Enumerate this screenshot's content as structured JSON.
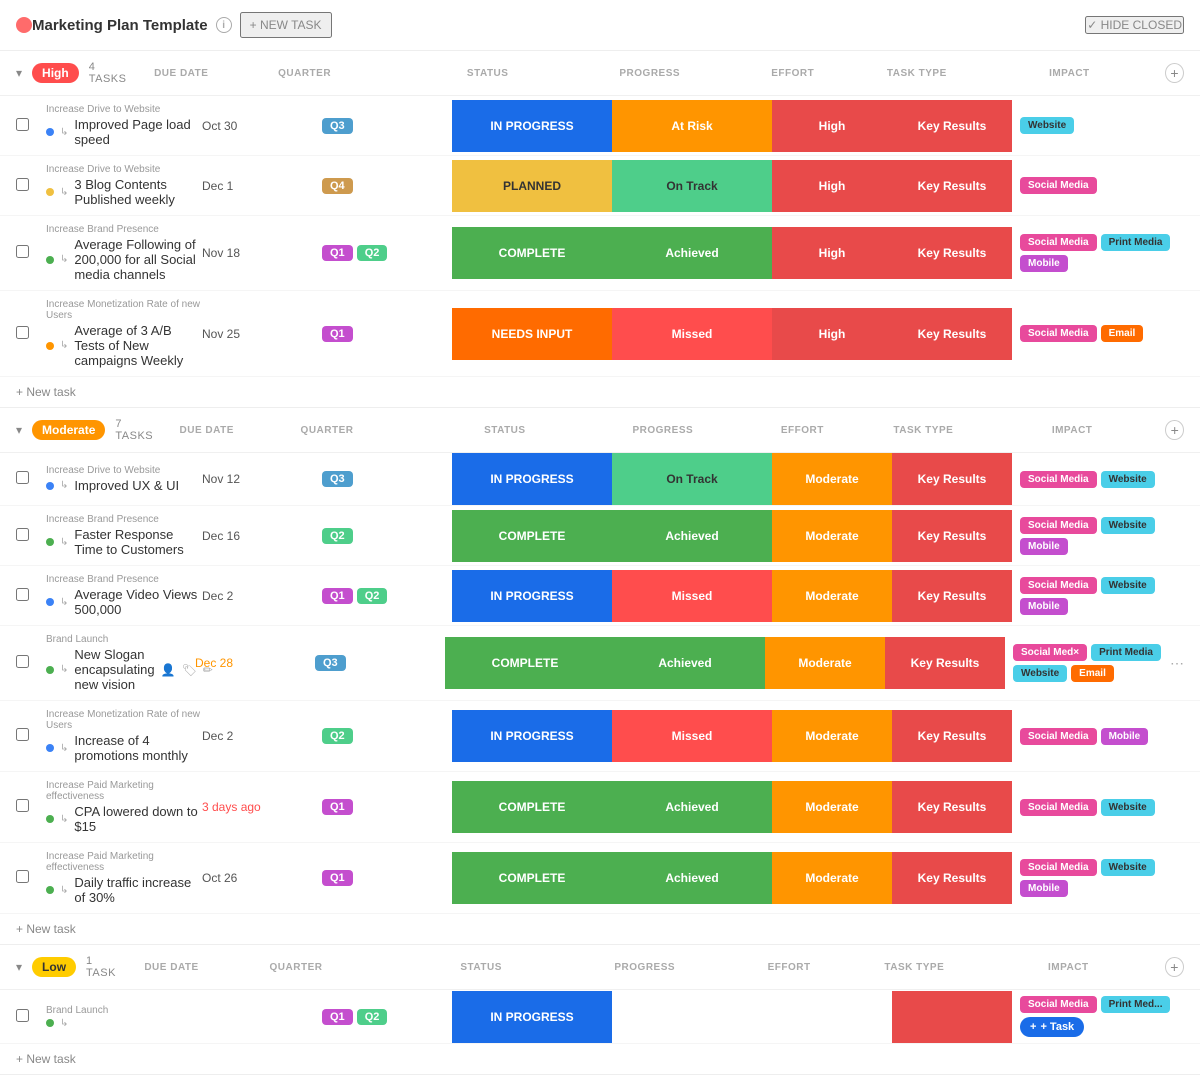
{
  "header": {
    "icon": "●",
    "title": "Marketing Plan Template",
    "new_task_label": "+ NEW TASK",
    "hide_closed_label": "✓ HIDE CLOSED"
  },
  "columns": {
    "task": "",
    "due_date": "DUE DATE",
    "quarter": "QUARTER",
    "status": "STATUS",
    "progress": "PROGRESS",
    "effort": "EFFORT",
    "task_type": "TASK TYPE",
    "impact": "IMPACT"
  },
  "sections": [
    {
      "id": "high",
      "priority": "High",
      "priority_class": "priority-high",
      "task_count": "4 TASKS",
      "tasks": [
        {
          "category": "Increase Drive to Website",
          "name": "Improved Page load speed",
          "dot_color": "#3b82f6",
          "due_date": "Oct 30",
          "due_date_class": "",
          "quarters": [
            {
              "label": "Q3",
              "class": "q3"
            }
          ],
          "status": "IN PROGRESS",
          "status_class": "status-in-progress",
          "progress": "At Risk",
          "progress_class": "progress-at-risk",
          "effort": "High",
          "effort_class": "effort-high",
          "task_type": "Key Results",
          "impact_tags": [
            {
              "label": "Website",
              "class": "tag-website"
            }
          ]
        },
        {
          "category": "Increase Drive to Website",
          "name": "3 Blog Contents Published weekly",
          "dot_color": "#f0c040",
          "due_date": "Dec 1",
          "due_date_class": "",
          "quarters": [
            {
              "label": "Q4",
              "class": "q4"
            }
          ],
          "status": "PLANNED",
          "status_class": "status-planned",
          "progress": "On Track",
          "progress_class": "progress-on-track",
          "effort": "High",
          "effort_class": "effort-high",
          "task_type": "Key Results",
          "impact_tags": [
            {
              "label": "Social Media",
              "class": "tag-social-media"
            }
          ]
        },
        {
          "category": "Increase Brand Presence",
          "name": "Average Following of 200,000 for all Social media channels",
          "dot_color": "#4caf50",
          "due_date": "Nov 18",
          "due_date_class": "",
          "quarters": [
            {
              "label": "Q1",
              "class": "q1"
            },
            {
              "label": "Q2",
              "class": "q2"
            }
          ],
          "status": "COMPLETE",
          "status_class": "status-complete",
          "progress": "Achieved",
          "progress_class": "progress-achieved",
          "effort": "High",
          "effort_class": "effort-high",
          "task_type": "Key Results",
          "impact_tags": [
            {
              "label": "Social Media",
              "class": "tag-social-media"
            },
            {
              "label": "Print Media",
              "class": "tag-print-media"
            },
            {
              "label": "Mobile",
              "class": "tag-mobile"
            }
          ]
        },
        {
          "category": "Increase Monetization Rate of new Users",
          "name": "Average of 3 A/B Tests of New campaigns Weekly",
          "dot_color": "#ff9500",
          "due_date": "Nov 25",
          "due_date_class": "",
          "quarters": [
            {
              "label": "Q1",
              "class": "q1"
            }
          ],
          "status": "NEEDS INPUT",
          "status_class": "status-needs-input",
          "progress": "Missed",
          "progress_class": "progress-missed",
          "effort": "High",
          "effort_class": "effort-high",
          "task_type": "Key Results",
          "impact_tags": [
            {
              "label": "Social Media",
              "class": "tag-social-media"
            },
            {
              "label": "Email",
              "class": "tag-email"
            }
          ]
        }
      ]
    },
    {
      "id": "moderate",
      "priority": "Moderate",
      "priority_class": "priority-moderate",
      "task_count": "7 TASKS",
      "tasks": [
        {
          "category": "Increase Drive to Website",
          "name": "Improved UX & UI",
          "dot_color": "#3b82f6",
          "due_date": "Nov 12",
          "due_date_class": "",
          "quarters": [
            {
              "label": "Q3",
              "class": "q3"
            }
          ],
          "status": "IN PROGRESS",
          "status_class": "status-in-progress",
          "progress": "On Track",
          "progress_class": "progress-on-track",
          "effort": "Moderate",
          "effort_class": "effort-moderate",
          "task_type": "Key Results",
          "impact_tags": [
            {
              "label": "Social Media",
              "class": "tag-social-media"
            },
            {
              "label": "Website",
              "class": "tag-website"
            }
          ]
        },
        {
          "category": "Increase Brand Presence",
          "name": "Faster Response Time to Customers",
          "dot_color": "#4caf50",
          "due_date": "Dec 16",
          "due_date_class": "",
          "quarters": [
            {
              "label": "Q2",
              "class": "q2"
            }
          ],
          "status": "COMPLETE",
          "status_class": "status-complete",
          "progress": "Achieved",
          "progress_class": "progress-achieved",
          "effort": "Moderate",
          "effort_class": "effort-moderate",
          "task_type": "Key Results",
          "impact_tags": [
            {
              "label": "Social Media",
              "class": "tag-social-media"
            },
            {
              "label": "Website",
              "class": "tag-website"
            },
            {
              "label": "Mobile",
              "class": "tag-mobile"
            }
          ]
        },
        {
          "category": "Increase Brand Presence",
          "name": "Average Video Views 500,000",
          "dot_color": "#3b82f6",
          "due_date": "Dec 2",
          "due_date_class": "",
          "quarters": [
            {
              "label": "Q1",
              "class": "q1"
            },
            {
              "label": "Q2",
              "class": "q2"
            }
          ],
          "status": "IN PROGRESS",
          "status_class": "status-in-progress",
          "progress": "Missed",
          "progress_class": "progress-missed",
          "effort": "Moderate",
          "effort_class": "effort-moderate",
          "task_type": "Key Results",
          "impact_tags": [
            {
              "label": "Social Media",
              "class": "tag-social-media"
            },
            {
              "label": "Website",
              "class": "tag-website"
            },
            {
              "label": "Mobile",
              "class": "tag-mobile"
            }
          ]
        },
        {
          "category": "Brand Launch",
          "name": "New Slogan encapsulating new vision",
          "dot_color": "#4caf50",
          "due_date": "Dec 28",
          "due_date_class": "upcoming",
          "quarters": [
            {
              "label": "Q3",
              "class": "q3"
            }
          ],
          "status": "COMPLETE",
          "status_class": "status-complete",
          "progress": "Achieved",
          "progress_class": "progress-achieved",
          "effort": "Moderate",
          "effort_class": "effort-moderate",
          "task_type": "Key Results",
          "impact_tags": [
            {
              "label": "Social Med×",
              "class": "tag-social-media"
            },
            {
              "label": "Print Media",
              "class": "tag-print-media"
            },
            {
              "label": "Website",
              "class": "tag-website"
            },
            {
              "label": "Email",
              "class": "tag-email"
            }
          ],
          "has_actions": true
        },
        {
          "category": "Increase Monetization Rate of new Users",
          "name": "Increase of 4 promotions monthly",
          "dot_color": "#3b82f6",
          "due_date": "Dec 2",
          "due_date_class": "",
          "quarters": [
            {
              "label": "Q2",
              "class": "q2"
            }
          ],
          "status": "IN PROGRESS",
          "status_class": "status-in-progress",
          "progress": "Missed",
          "progress_class": "progress-missed",
          "effort": "Moderate",
          "effort_class": "effort-moderate",
          "task_type": "Key Results",
          "impact_tags": [
            {
              "label": "Social Media",
              "class": "tag-social-media"
            },
            {
              "label": "Mobile",
              "class": "tag-mobile"
            }
          ]
        },
        {
          "category": "Increase Paid Marketing effectiveness",
          "name": "CPA lowered down to $15",
          "dot_color": "#4caf50",
          "due_date": "3 days ago",
          "due_date_class": "overdue",
          "quarters": [
            {
              "label": "Q1",
              "class": "q1"
            }
          ],
          "status": "COMPLETE",
          "status_class": "status-complete",
          "progress": "Achieved",
          "progress_class": "progress-achieved",
          "effort": "Moderate",
          "effort_class": "effort-moderate",
          "task_type": "Key Results",
          "impact_tags": [
            {
              "label": "Social Media",
              "class": "tag-social-media"
            },
            {
              "label": "Website",
              "class": "tag-website"
            }
          ]
        },
        {
          "category": "Increase Paid Marketing effectiveness",
          "name": "Daily traffic increase of 30%",
          "dot_color": "#4caf50",
          "due_date": "Oct 26",
          "due_date_class": "",
          "quarters": [
            {
              "label": "Q1",
              "class": "q1"
            }
          ],
          "status": "COMPLETE",
          "status_class": "status-complete",
          "progress": "Achieved",
          "progress_class": "progress-achieved",
          "effort": "Moderate",
          "effort_class": "effort-moderate",
          "task_type": "Key Results",
          "impact_tags": [
            {
              "label": "Social Media",
              "class": "tag-social-media"
            },
            {
              "label": "Website",
              "class": "tag-website"
            },
            {
              "label": "Mobile",
              "class": "tag-mobile"
            }
          ]
        }
      ]
    },
    {
      "id": "low",
      "priority": "Low",
      "priority_class": "priority-low",
      "task_count": "1 TASK",
      "tasks": [
        {
          "category": "Brand Launch",
          "name": "",
          "dot_color": "#4caf50",
          "due_date": "",
          "due_date_class": "",
          "quarters": [
            {
              "label": "Q1",
              "class": "q1"
            },
            {
              "label": "Q2",
              "class": "q2"
            }
          ],
          "status": "IN PROGRESS",
          "status_class": "status-in-progress",
          "progress": "",
          "progress_class": "",
          "effort": "",
          "effort_class": "",
          "task_type": "",
          "impact_tags": [
            {
              "label": "Social Media",
              "class": "tag-social-media"
            },
            {
              "label": "Print Med...",
              "class": "tag-print-media"
            }
          ]
        }
      ]
    }
  ],
  "new_task_label": "+ New task",
  "add_task_label": "+ Task"
}
